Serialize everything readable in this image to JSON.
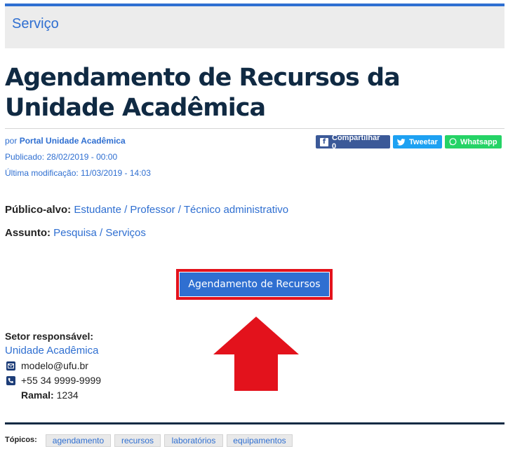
{
  "header": {
    "section_label": "Serviço"
  },
  "article": {
    "title": "Agendamento de Recursos da Unidade Acadêmica",
    "author_prefix": "por",
    "author": "Portal Unidade Acadêmica",
    "published": "Publicado: 28/02/2019 - 00:00",
    "modified": "Última modificação: 11/03/2019 - 14:03"
  },
  "share": {
    "facebook_label": "Compartilhar 0",
    "twitter_label": "Tweetar",
    "whatsapp_label": "Whatsapp",
    "facebook_icon": "facebook-icon",
    "twitter_icon": "twitter-icon",
    "whatsapp_icon": "whatsapp-icon"
  },
  "audience": {
    "label": "Público-alvo:",
    "value": "Estudante / Professor / Técnico administrativo"
  },
  "subject": {
    "label": "Assunto:",
    "value": "Pesquisa / Serviços"
  },
  "cta": {
    "label": "Agendamento de Recursos",
    "highlight_color": "#e3121c"
  },
  "responsible": {
    "label": "Setor responsável:",
    "unit": "Unidade Acadêmica",
    "email": "modelo@ufu.br",
    "phone": "+55 34 9999-9999",
    "extension_label": "Ramal:",
    "extension": "1234"
  },
  "topics": {
    "label": "Tópicos:",
    "tags": [
      "agendamento",
      "recursos",
      "laboratórios",
      "equipamentos"
    ]
  },
  "colors": {
    "accent": "#2f6fd1",
    "title": "#102a43",
    "arrow": "#e3121c"
  }
}
